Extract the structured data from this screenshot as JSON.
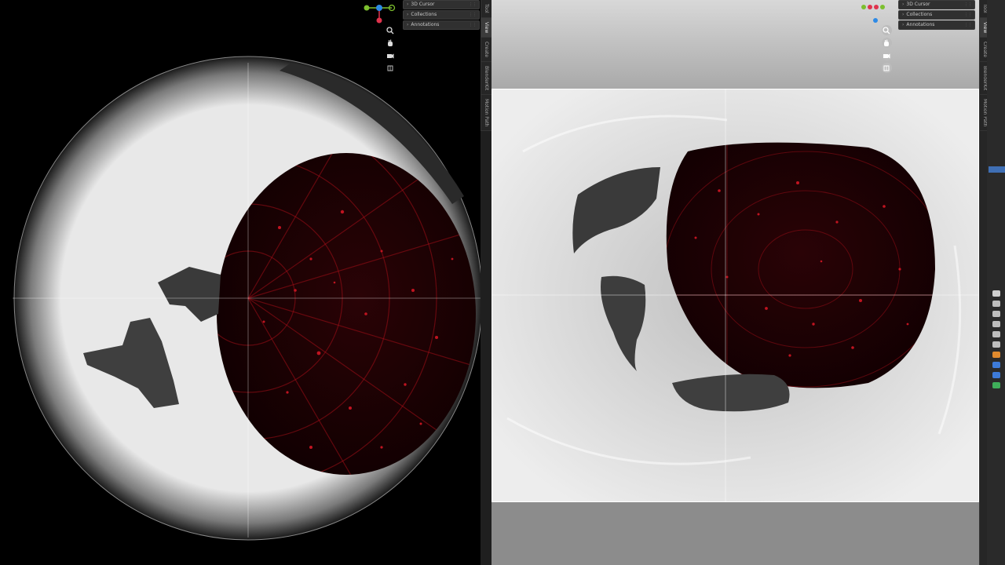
{
  "left_viewport": {
    "npanel": [
      {
        "label": "3D Cursor"
      },
      {
        "label": "Collections"
      },
      {
        "label": "Annotations"
      }
    ],
    "side_tabs": [
      {
        "label": "Tool"
      },
      {
        "label": "View"
      },
      {
        "label": "Create"
      },
      {
        "label": "BlenderKit"
      },
      {
        "label": "Motion Path"
      }
    ]
  },
  "right_viewport": {
    "npanel": [
      {
        "label": "3D Cursor"
      },
      {
        "label": "Collections"
      },
      {
        "label": "Annotations"
      }
    ],
    "side_tabs": [
      {
        "label": "Tool"
      },
      {
        "label": "View"
      },
      {
        "label": "Create"
      },
      {
        "label": "BlenderKit"
      },
      {
        "label": "Motion Path"
      }
    ]
  },
  "icons": {
    "zoom": "zoom-icon",
    "pan": "hand-icon",
    "camera": "camera-icon",
    "perspective": "grid-icon"
  },
  "colors": {
    "night_red": "#b0101a",
    "ui_bg": "#303030",
    "gizmo_x": "#e0334d",
    "gizmo_y": "#7cbf2e",
    "gizmo_z": "#2d8ae6"
  }
}
